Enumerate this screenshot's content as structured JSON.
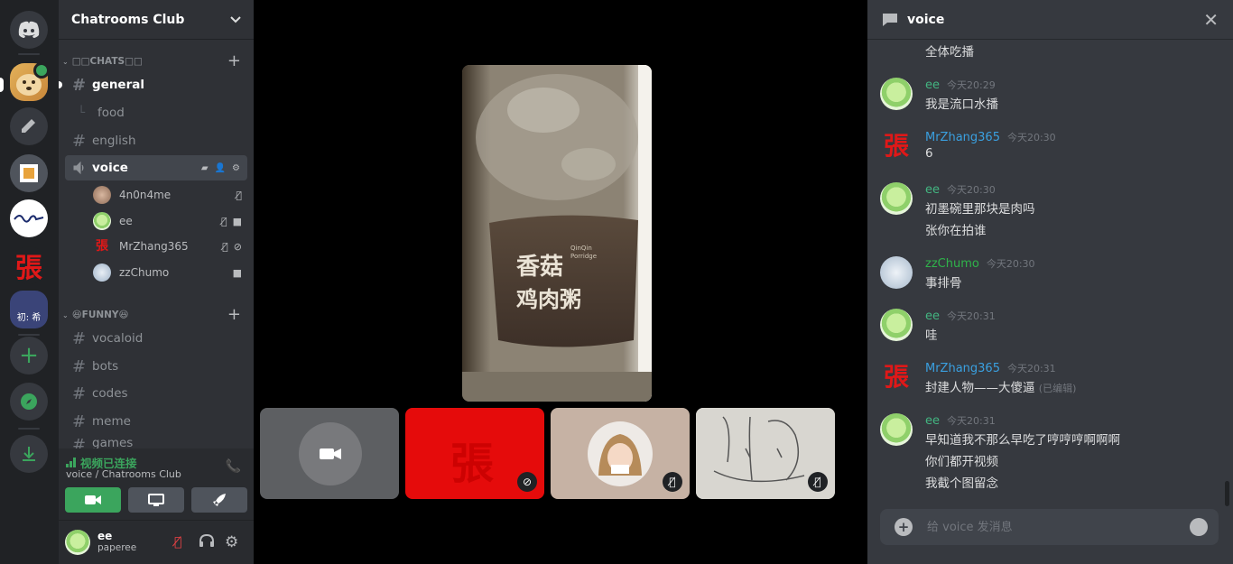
{
  "server": {
    "name": "Chatrooms Club"
  },
  "categories": [
    {
      "name": "□□CHATS□□"
    },
    {
      "name": "😆FUNNY😆"
    }
  ],
  "channels": {
    "general": "general",
    "food": "food",
    "english": "english",
    "voice": "voice",
    "vocaloid": "vocaloid",
    "bots": "bots",
    "codes": "codes",
    "meme": "meme",
    "games": "games"
  },
  "voice_users": [
    {
      "name": "4n0n4me"
    },
    {
      "name": "ee"
    },
    {
      "name": "MrZhang365"
    },
    {
      "name": "zzChumo"
    }
  ],
  "voice_status": {
    "title": "视频已连接",
    "subtitle": "voice / Chatrooms Club"
  },
  "me": {
    "name": "ee",
    "status": "paperee"
  },
  "zhang_char": "張",
  "rail_labels": {
    "server5": "初: 希"
  },
  "stage": {
    "bottle_text": "香菇\n鸡肉粥",
    "bottle_brand": "QinQin\nPorridge"
  },
  "chat": {
    "channel": "voice",
    "placeholder": "给 voice 发消息",
    "top_line": "全体吃播",
    "messages": [
      {
        "author": "ee",
        "time": "今天20:29",
        "lines": [
          "我是流口水播"
        ]
      },
      {
        "author": "MrZhang365",
        "time": "今天20:30",
        "lines": [
          "6"
        ]
      },
      {
        "author": "ee",
        "time": "今天20:30",
        "lines": [
          "初墨碗里那块是肉吗",
          "张你在拍谁"
        ]
      },
      {
        "author": "zzChumo",
        "time": "今天20:30",
        "lines": [
          "事排骨"
        ]
      },
      {
        "author": "ee",
        "time": "今天20:31",
        "lines": [
          "哇"
        ]
      },
      {
        "author": "MrZhang365",
        "time": "今天20:31",
        "lines": [
          "封建人物——大傻逼"
        ],
        "edited": "(已编辑)"
      },
      {
        "author": "ee",
        "time": "今天20:31",
        "lines": [
          "早知道我不那么早吃了哼哼哼啊啊啊",
          "你们都开视频",
          "我截个图留念"
        ]
      }
    ]
  },
  "colors": {
    "green": "#3ba55d",
    "blurple": "#5865f2",
    "ee_name": "#43b581",
    "zhang_name": "#3aa0e0",
    "zzchumo_name": "#2fb34a"
  }
}
